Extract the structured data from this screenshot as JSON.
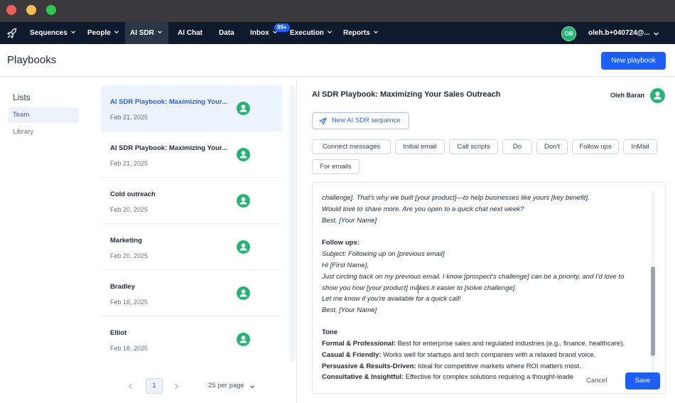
{
  "colors": {
    "accent": "#1d5ffa",
    "nav_bg": "#0e1a2e",
    "avatar_green": "#22b573",
    "selected_bg": "#edf3fc"
  },
  "nav": {
    "logo_icon": "rocket-icon",
    "items": [
      {
        "label": "Sequences",
        "has_menu": true
      },
      {
        "label": "People",
        "has_menu": true
      },
      {
        "label": "AI SDR",
        "has_menu": true,
        "active": true
      },
      {
        "label": "AI Chat",
        "has_menu": false
      },
      {
        "label": "Data",
        "has_menu": false
      },
      {
        "label": "Inbox",
        "has_menu": true
      },
      {
        "label": "Execution",
        "has_menu": true
      },
      {
        "label": "Reports",
        "has_menu": true
      }
    ],
    "inbox_badge": "99+",
    "user_initials": "OB",
    "user_email": "oleh.b+040724@..."
  },
  "page": {
    "title": "Playbooks",
    "new_playbook_label": "New playbook"
  },
  "lists": {
    "title": "Lists",
    "items": [
      "Team",
      "Library"
    ],
    "selected": "Team"
  },
  "playbooks": [
    {
      "title": "AI SDR Playbook: Maximizing Your...",
      "date": "Feb 21, 2025",
      "selected": true
    },
    {
      "title": "AI SDR Playbook: Maximizing Your...",
      "date": "Feb 21, 2025"
    },
    {
      "title": "Cold outreach",
      "date": "Feb 20, 2025"
    },
    {
      "title": "Marketing",
      "date": "Feb 20, 2025"
    },
    {
      "title": "Bradley",
      "date": "Feb 18, 2025"
    },
    {
      "title": "Elliot",
      "date": "Feb 18, 2025"
    }
  ],
  "pagination": {
    "current_page": "1",
    "per_page": "25 per page"
  },
  "detail": {
    "title": "AI SDR Playbook: Maximizing Your Sales Outreach",
    "author": "Oleh Baran",
    "new_sequence_label": "New AI SDR sequence",
    "tabs": [
      "Connect messages",
      "Initial email",
      "Call scripts",
      "Do",
      "Don't",
      "Follow ups",
      "InMail",
      "For emails"
    ],
    "content_lines": [
      {
        "text": "challenge]. That's why we built [your product]—to help businesses like yours [key benefit].",
        "italic": true
      },
      {
        "text": "Would love to share more. Are you open to a quick chat next week?",
        "italic": true
      },
      {
        "text": "Best, [Your Name]",
        "italic": true
      },
      {
        "text": "Follow ups:",
        "heading": true
      },
      {
        "text": "Subject: Following up on [previous email]",
        "italic": true
      },
      {
        "text": "Hi [First Name],",
        "italic": true
      },
      {
        "text": "Just circling back on my previous email. I know [prospect's challenge] can be a priority, and I'd love to",
        "italic": true
      },
      {
        "text": "show you how [your product] makes it easier to [solve challenge].",
        "italic": true
      },
      {
        "text": "Let me know if you're available for a quick call!",
        "italic": true
      },
      {
        "text": "Best, [Your Name]",
        "italic": true
      },
      {
        "text": "Tone",
        "heading": true
      },
      {
        "label": "Formal & Professional:",
        "text": "Best for enterprise sales and regulated industries (e.g., finance, healthcare)."
      },
      {
        "label": "Casual & Friendly:",
        "text": "Works well for startups and tech companies with a relaxed brand voice."
      },
      {
        "label": "Persuasive & Results-Driven:",
        "text": "Ideal for competitive markets where ROI matters most."
      },
      {
        "label": "Consultative & Insightful:",
        "text": "Effective for complex solutions requiring a thought-leade"
      }
    ],
    "cancel_label": "Cancel",
    "save_label": "Save"
  }
}
